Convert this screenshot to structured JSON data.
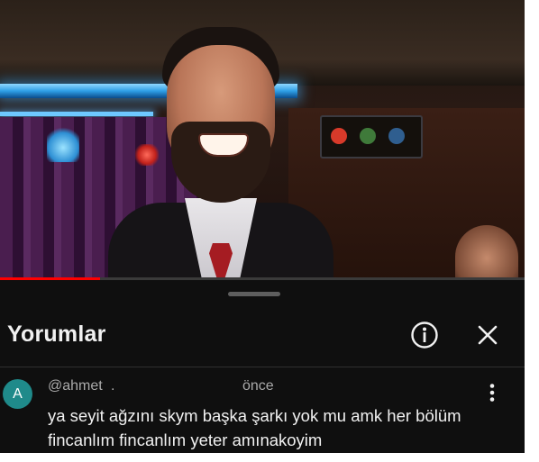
{
  "video": {
    "progress_fraction": 0.19
  },
  "comments_panel": {
    "title": "Yorumlar",
    "info_icon": "info-circle-icon",
    "close_icon": "close-icon",
    "comments": [
      {
        "avatar_letter": "A",
        "avatar_color": "#1f8a8a",
        "author": "@ahmet",
        "separator": ".",
        "time": "önce",
        "text": "ya seyit ağzını skym başka şarkı yok mu amk her bölüm fincanlım fincanlım yeter amınakoyim",
        "menu_icon": "more-vertical-icon"
      }
    ]
  }
}
